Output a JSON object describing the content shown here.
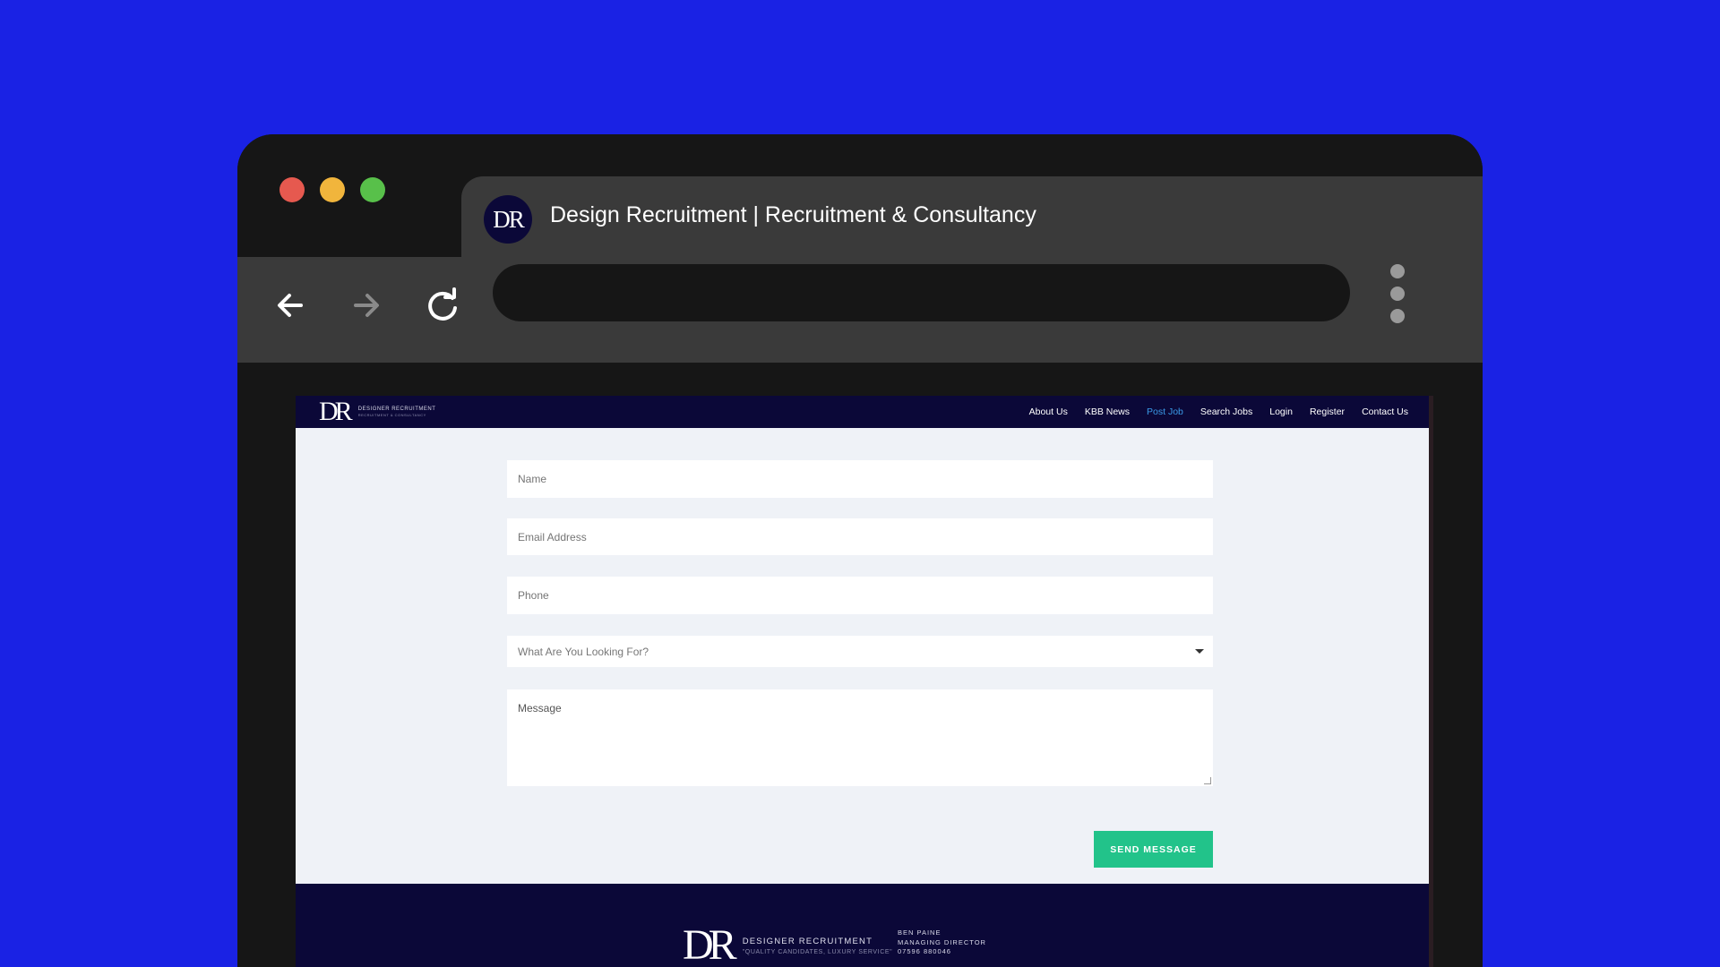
{
  "window": {
    "controls": [
      "close",
      "minimize",
      "maximize"
    ],
    "colors": {
      "close": "#e6594f",
      "minimize": "#f1b53c",
      "maximize": "#58c04a",
      "frame": "#161616",
      "chrome": "#3a3a3a"
    }
  },
  "tab": {
    "favicon_text": "DR",
    "title": "Design Recruitment | Recruitment & Consultancy"
  },
  "toolbar": {
    "back_icon": "arrow-left-icon",
    "forward_icon": "arrow-right-icon",
    "reload_icon": "reload-icon",
    "address_value": "",
    "menu_icon": "kebab-menu-icon"
  },
  "site": {
    "brand_color": "#0b0838",
    "accent_color": "#22c38a",
    "logo": {
      "mark": "DR",
      "line1": "DESIGNER RECRUITMENT",
      "line2": "RECRUITMENT & CONSULTANCY"
    },
    "nav": [
      {
        "label": "About Us",
        "active": false
      },
      {
        "label": "KBB News",
        "active": false
      },
      {
        "label": "Post Job",
        "active": true
      },
      {
        "label": "Search Jobs",
        "active": false
      },
      {
        "label": "Login",
        "active": false
      },
      {
        "label": "Register",
        "active": false
      },
      {
        "label": "Contact Us",
        "active": false
      }
    ]
  },
  "form": {
    "name_placeholder": "Name",
    "email_placeholder": "Email Address",
    "phone_placeholder": "Phone",
    "select_value": "What Are You Looking For?",
    "message_placeholder": "Message",
    "submit_label": "SEND MESSAGE"
  },
  "footer": {
    "logo_mark": "DR",
    "logo_line1": "DESIGNER RECRUITMENT",
    "logo_line2": "\"QUALITY CANDIDATES, LUXURY SERVICE\"",
    "contact_name": "BEN PAINE",
    "contact_role": "MANAGING DIRECTOR",
    "contact_phone": "07596 880046"
  }
}
